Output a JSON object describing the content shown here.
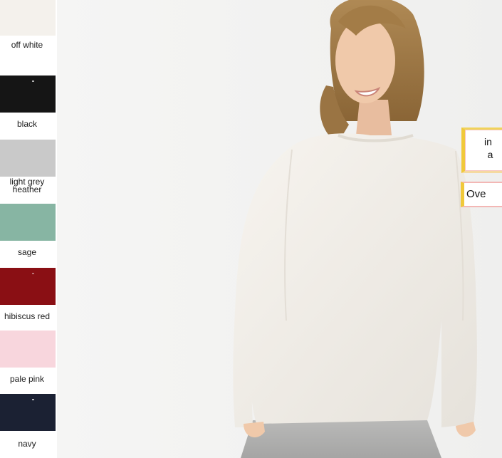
{
  "swatches": [
    {
      "label": "off white",
      "color": "#f4f1ec"
    },
    {
      "label": "black",
      "color": "#151515"
    },
    {
      "label": "light grey heather",
      "color": "#c9c9c9"
    },
    {
      "label": "sage",
      "color": "#87b5a3"
    },
    {
      "label": "hibiscus red",
      "color": "#8a0f14"
    },
    {
      "label": "pale pink",
      "color": "#f8d6dd"
    },
    {
      "label": "navy",
      "color": "#1b2133"
    }
  ],
  "badges": {
    "badge_1_line1": "in",
    "badge_1_line2": "a",
    "badge_2": "Ove"
  },
  "model_icon": "person-photo"
}
